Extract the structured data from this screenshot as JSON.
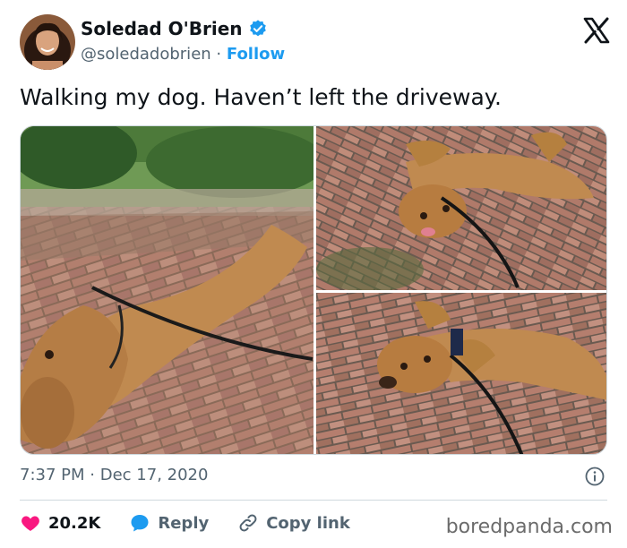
{
  "author": {
    "name": "Soledad O'Brien",
    "handle": "@soledadobrien",
    "separator": "·",
    "follow_label": "Follow",
    "verified": true
  },
  "tweet": {
    "text": "Walking my dog. Haven’t left the driveway.",
    "time": "7:37 PM",
    "separator": "·",
    "date": "Dec 17, 2020"
  },
  "actions": {
    "likes": "20.2K",
    "reply_label": "Reply",
    "copy_link_label": "Copy link"
  },
  "watermark": "boredpanda.com",
  "colors": {
    "accent": "#1d9bf0",
    "like": "#f91880",
    "muted": "#536471"
  },
  "icons": [
    "verified-badge-icon",
    "x-logo-icon",
    "info-icon",
    "heart-icon",
    "reply-bubble-icon",
    "link-icon"
  ]
}
